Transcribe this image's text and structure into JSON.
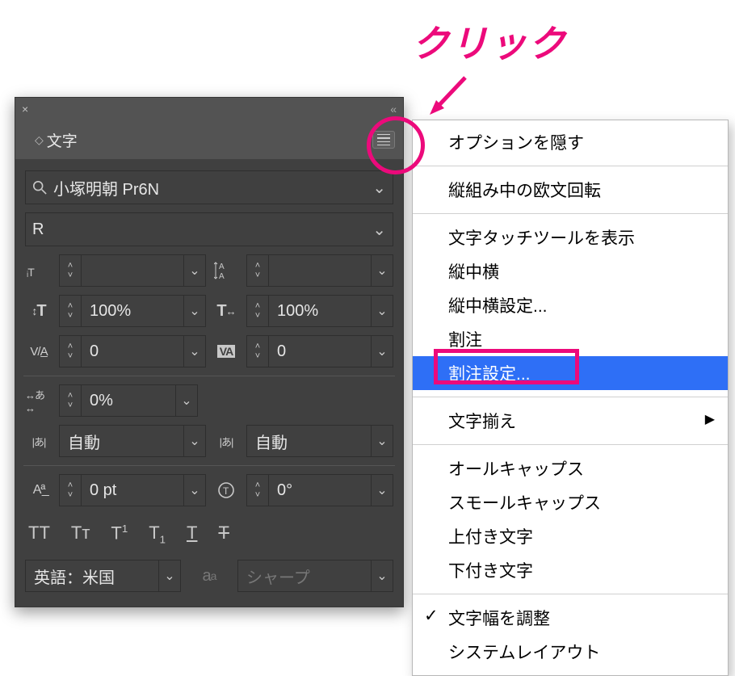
{
  "annotation": {
    "click_label": "クリック"
  },
  "panel": {
    "tab_title": "文字",
    "font_family": "小塚明朝 Pr6N",
    "font_style": "R",
    "fields": {
      "size": "",
      "leading": "",
      "vscale": "100%",
      "hscale": "100%",
      "kerning": "0",
      "tracking": "0",
      "tsume": "0%",
      "aki_before": "自動",
      "aki_after": "自動",
      "baseline": "0 pt",
      "rotation": "0°"
    },
    "language": "英語：米国",
    "antialias_label": "シャープ"
  },
  "menu": {
    "items": [
      {
        "label": "オプションを隠す"
      },
      {
        "sep": true
      },
      {
        "label": "縦組み中の欧文回転"
      },
      {
        "sep": true
      },
      {
        "label": "文字タッチツールを表示"
      },
      {
        "label": "縦中横"
      },
      {
        "label": "縦中横設定..."
      },
      {
        "label": "割注"
      },
      {
        "label": "割注設定...",
        "selected": true
      },
      {
        "sep": true
      },
      {
        "label": "文字揃え",
        "submenu": true
      },
      {
        "sep": true
      },
      {
        "label": "オールキャップス"
      },
      {
        "label": "スモールキャップス"
      },
      {
        "label": "上付き文字"
      },
      {
        "label": "下付き文字"
      },
      {
        "sep": true
      },
      {
        "label": "文字幅を調整",
        "checked": true
      },
      {
        "label": "システムレイアウト"
      }
    ]
  }
}
